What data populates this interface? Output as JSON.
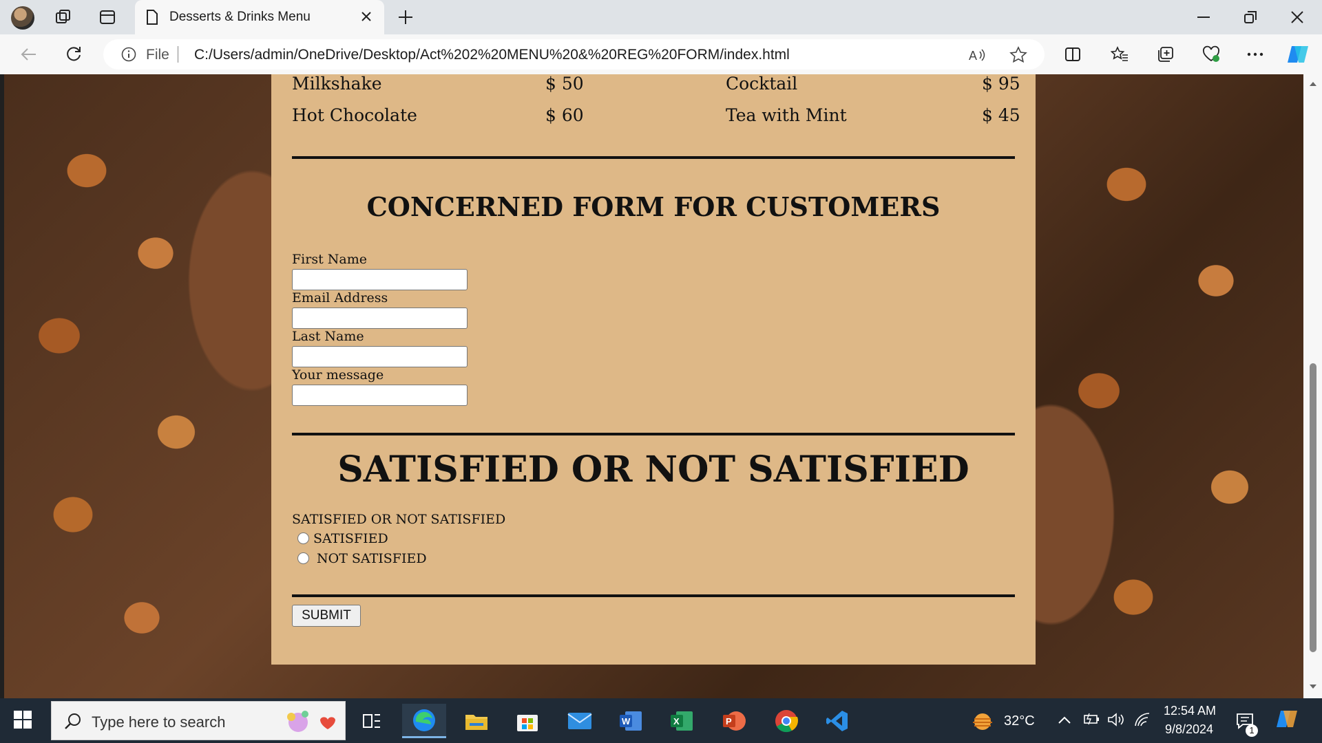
{
  "browser": {
    "tab_title": "Desserts & Drinks Menu",
    "address_prefix": "File",
    "url": "C:/Users/admin/OneDrive/Desktop/Act%202%20MENU%20&%20REG%20FORM/index.html"
  },
  "menu": {
    "items": [
      {
        "name": "Milkshake",
        "price": "$ 50"
      },
      {
        "name": "Cocktail",
        "price": "$ 95"
      },
      {
        "name": "Hot Chocolate",
        "price": "$ 60"
      },
      {
        "name": "Tea with Mint",
        "price": "$ 45"
      }
    ]
  },
  "form": {
    "heading": "CONCERNED FORM FOR CUSTOMERS",
    "fields": [
      {
        "label": "First Name",
        "value": ""
      },
      {
        "label": "Email Address",
        "value": ""
      },
      {
        "label": "Last Name",
        "value": ""
      },
      {
        "label": "Your message",
        "value": ""
      }
    ]
  },
  "satisfaction": {
    "heading": "SATISFIED OR NOT SATISFIED",
    "question": "SATISFIED OR NOT SATISFIED",
    "options": [
      "SATISFIED",
      "NOT SATISFIED"
    ]
  },
  "submit_label": "SUBMIT",
  "taskbar": {
    "search_placeholder": "Type here to search",
    "weather": "32°C",
    "time": "12:54 AM",
    "date": "9/8/2024",
    "notification_count": "1"
  }
}
